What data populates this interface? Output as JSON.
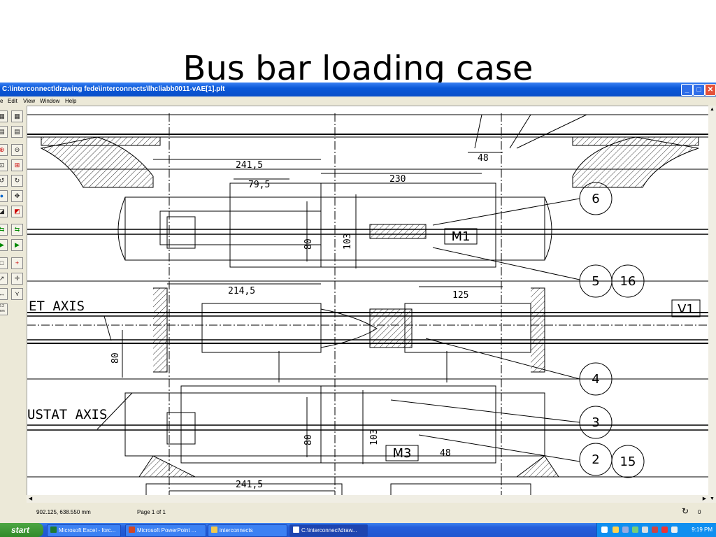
{
  "slide": {
    "title": "Bus bar loading case"
  },
  "window": {
    "title": "C:\\interconnect\\drawing fede\\interconnects\\lhcliabb0011-vAE[1].plt",
    "controls": {
      "minimize": "_",
      "maximize": "□",
      "close": "✕"
    }
  },
  "menu": {
    "items": [
      "e",
      "Edit",
      "View",
      "Window",
      "Help"
    ]
  },
  "toolbar": {
    "icons": [
      "page-icon",
      "page-alt-icon",
      "print-icon",
      "print-preview-icon",
      "zoom-in-icon",
      "zoom-out-icon",
      "zoom-window-icon",
      "zoom-all-icon",
      "rotate-left-icon",
      "rotate-right-icon",
      "color-icon",
      "pan-icon",
      "layer-icon",
      "erase-icon",
      "copy-icon",
      "paste-icon",
      "next-page-icon",
      "prev-page-icon",
      "rectangle-icon",
      "add-icon",
      "arrow-icon",
      "move-icon",
      "measure-icon",
      "check-icon",
      "info-icon"
    ],
    "text_labels": [
      "2.2\nmm"
    ]
  },
  "drawing": {
    "dimensions": [
      "241,5",
      "79,5",
      "230",
      "48",
      "80",
      "103",
      "214,5",
      "125",
      "80",
      "80",
      "103",
      "48",
      "241,5"
    ],
    "callouts": [
      "6",
      "5",
      "16",
      "4",
      "3",
      "2",
      "15"
    ],
    "boxes": [
      "M1",
      "V1",
      "M3"
    ],
    "axis_labels": [
      "ET AXIS",
      "USTAT AXIS"
    ]
  },
  "statusbar": {
    "coords": "902.125, 638.550 mm",
    "page": "Page 1 of 1",
    "zero": "0"
  },
  "taskbar": {
    "start": "start",
    "tasks": [
      "Microsoft Excel - forc...",
      "Microsoft PowerPoint ...",
      "interconnects",
      "C:\\interconnect\\draw..."
    ],
    "clock": "9:19 PM"
  },
  "colors": {
    "titlebar": "#0a58d8",
    "taskbar": "#245edb",
    "start": "#3b9a33",
    "drawing_line": "#000000"
  }
}
